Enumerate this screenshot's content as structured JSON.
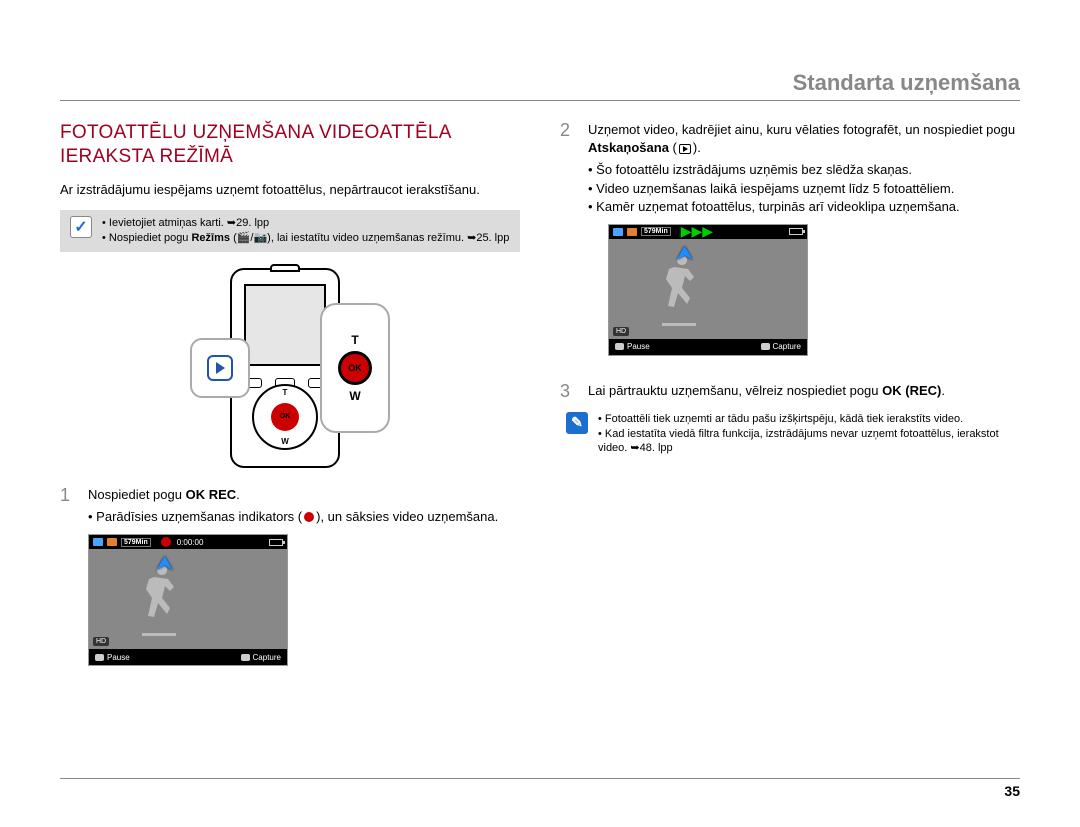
{
  "header": {
    "title": "Standarta uzņemšana"
  },
  "left": {
    "section_title": "FOTOATTĒLU UZŅEMŠANA VIDEOATTĒLA IERAKSTA REŽĪMĀ",
    "intro": "Ar izstrādājumu iespējams uzņemt fotoattēlus, nepārtraucot ierakstīšanu.",
    "note1_li1": "Ievietojiet atmiņas karti. ➥29. lpp",
    "note1_li2_a": "Nospiediet pogu ",
    "note1_li2_b": "Režīms",
    "note1_li2_c": " (🎬/📷), lai iestatītu video uzņemšanas režīmu. ➥25. lpp",
    "step1_num": "1",
    "step1_a": "Nospiediet pogu ",
    "step1_b": "OK REC",
    "step1_c": ".",
    "step1_bullet": "Parādīsies uzņemšanas indikators (●), un sāksies video uzņemšana.",
    "camera": {
      "ok": "OK",
      "t": "T",
      "w": "W"
    },
    "lcd": {
      "min": "579Min",
      "time": "0:00:00",
      "pause": "Pause",
      "capture": "Capture",
      "hd": "HD"
    }
  },
  "right": {
    "step2_num": "2",
    "step2_a": "Uzņemot video, kadrējiet ainu, kuru vēlaties fotografēt, un nospiediet pogu ",
    "step2_b": "Atskaņošana",
    "step2_c": " ( ▶ ).",
    "step2_bullets": [
      "Šo fotoattēlu izstrādājums uzņēmis bez slēdža skaņas.",
      "Video uzņemšanas laikā iespējams uzņemt līdz 5 fotoattēliem.",
      "Kamēr uzņemat fotoattēlus, turpinās arī videoklipa uzņemšana."
    ],
    "lcd": {
      "min": "579Min",
      "pause": "Pause",
      "capture": "Capture",
      "hd": "HD",
      "green": "⯮⯮"
    },
    "step3_num": "3",
    "step3_a": "Lai pārtrauktu uzņemšanu, vēlreiz nospiediet pogu ",
    "step3_b": "OK (REC)",
    "step3_c": ".",
    "note2_li1": "Fotoattēli tiek uzņemti ar tādu pašu izšķirtspēju, kādā tiek ierakstīts video.",
    "note2_li2": "Kad iestatīta viedā filtra funkcija, izstrādājums nevar uzņemt fotoattēlus, ierakstot video. ➥48. lpp"
  },
  "page_number": "35"
}
